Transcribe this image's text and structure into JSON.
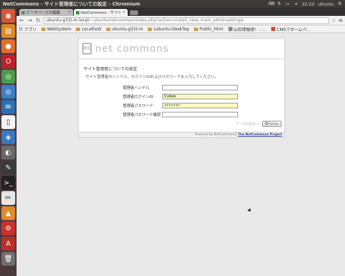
{
  "window": {
    "title": "NetCommons - サイト管理者についての設定 - Chromium",
    "time": "22:22",
    "user": "ubuntu"
  },
  "tabs": [
    {
      "label": "データベースの編集",
      "active": false,
      "color": "#7a7a7a"
    },
    {
      "label": "NetCommons - サイト管理",
      "active": true,
      "color": "#3f8e3f"
    }
  ],
  "address": {
    "host": "ubuntu-g31t-m.local",
    "path": "/~ubuntu/netcommon/index.php?action=install_view_main_adminsetting&"
  },
  "bookmarks": [
    {
      "label": "アプリ",
      "icon": "apps-icon"
    },
    {
      "label": "WebSystem",
      "icon": "folder-icon"
    },
    {
      "label": "Localhost",
      "icon": "folder-icon"
    },
    {
      "label": "ubuntu-g31t-m",
      "icon": "folder-icon"
    },
    {
      "label": "Lubuntu-DeskTop",
      "icon": "folder-icon"
    },
    {
      "label": "Public_html",
      "icon": "folder-icon"
    },
    {
      "label": "山形情報使！ - ...",
      "icon": "site-icon"
    },
    {
      "label": "CMSでホームペ...",
      "icon": "site-icon"
    }
  ],
  "header": {
    "logo_mark": "nc",
    "logo_text": "net commons"
  },
  "section": {
    "title": "サイト管理者についての設定",
    "description": "サイト管理者のハンドル、ログインIDおよびパスワードを入力してください。"
  },
  "form": {
    "handle_label": "管理者ハンドル",
    "handle_value": "",
    "login_label": "管理者ログインID",
    "login_value": "Cubes",
    "password_label": "管理者パスワード",
    "password_value": "•••••••",
    "confirm_label": "管理者パスワード確認",
    "confirm_value": ""
  },
  "actions": {
    "hint": "データの生成>>",
    "next_label": "次へ>>"
  },
  "footer": {
    "prefix": "Powered by NetCommons2",
    "link": "The NetCommons Project"
  }
}
